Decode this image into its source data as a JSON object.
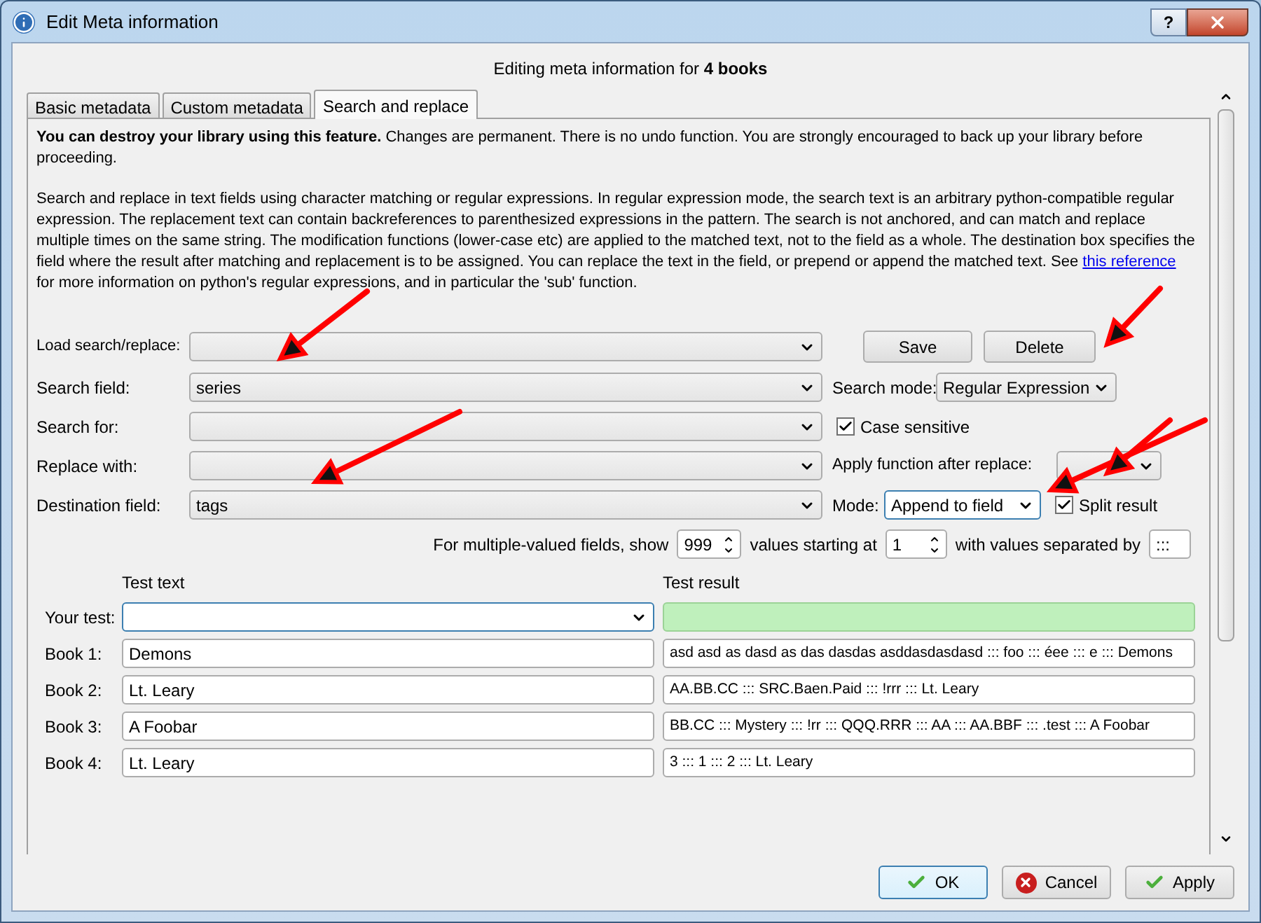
{
  "window": {
    "title": "Edit Meta information",
    "help": "?"
  },
  "header": "Editing meta information for **4 books**",
  "tabs": [
    {
      "label": "Basic metadata",
      "selected": false
    },
    {
      "label": "Custom metadata",
      "selected": false
    },
    {
      "label": "Search and replace",
      "selected": true
    }
  ],
  "warning": "**You can destroy your library using this feature.** Changes are permanent. There is no undo function. You are strongly encouraged to back up your library before proceeding.",
  "description": {
    "before": "Search and replace in text fields using character matching or regular expressions. In regular expression mode, the search text is an arbitrary python-compatible regular expression. The replacement text can contain backreferences to parenthesized expressions in the pattern. The search is not anchored, and can match and replace multiple times on the same string. The modification functions (lower-case etc) are applied to the matched text, not to the field as a whole. The destination box specifies the field where the result after matching and replacement is to be assigned. You can replace the text in the field, or prepend or append the matched text. See",
    "link": "this reference",
    "after": "for more information on python's regular expressions, and in particular the 'sub' function."
  },
  "load": {
    "label": "Load search/replace:"
  },
  "save_button": "Save",
  "delete_button": "Delete",
  "search_field": {
    "label": "Search field:",
    "value": "series"
  },
  "search_mode": {
    "label": "Search mode:",
    "value": "Regular Expression"
  },
  "search_for": {
    "label": "Search for:"
  },
  "case_sensitive": {
    "label": "Case sensitive",
    "checked": true
  },
  "replace_with": {
    "label": "Replace with:"
  },
  "apply_function": {
    "label": "Apply function after replace:"
  },
  "destination": {
    "label": "Destination field:",
    "value": "tags"
  },
  "mode": {
    "label": "Mode:",
    "value": "Append to field"
  },
  "split_result": {
    "label": "Split result",
    "checked": true
  },
  "multi": {
    "show_label": "For multiple-valued fields, show",
    "show_value": "999",
    "start_label": "values starting at",
    "start_value": "1",
    "sep_label": "with values separated by",
    "sep_value": ":::"
  },
  "test": {
    "text_heading": "Test text",
    "result_heading": "Test result",
    "your_test_label": "Your test:",
    "books": [
      {
        "label": "Book 1:",
        "text": "Demons",
        "result": "asd asd as dasd as das dasdas asddasdasdasd ::: foo ::: éee ::: e ::: Demons"
      },
      {
        "label": "Book 2:",
        "text": "Lt. Leary",
        "result": "AA.BB.CC ::: SRC.Baen.Paid ::: !rrr ::: Lt. Leary"
      },
      {
        "label": "Book 3:",
        "text": "A Foobar",
        "result": "BB.CC ::: Mystery ::: !rr ::: QQQ.RRR ::: AA ::: AA.BBF ::: .test ::: A Foobar"
      },
      {
        "label": "Book 4:",
        "text": "Lt. Leary",
        "result": "3 ::: 1 ::: 2 ::: Lt. Leary"
      }
    ]
  },
  "dialog_buttons": [
    {
      "label": "OK",
      "kind": "ok",
      "default": true
    },
    {
      "label": "Cancel",
      "kind": "cancel",
      "default": false
    },
    {
      "label": "Apply",
      "kind": "ok",
      "default": false
    }
  ]
}
